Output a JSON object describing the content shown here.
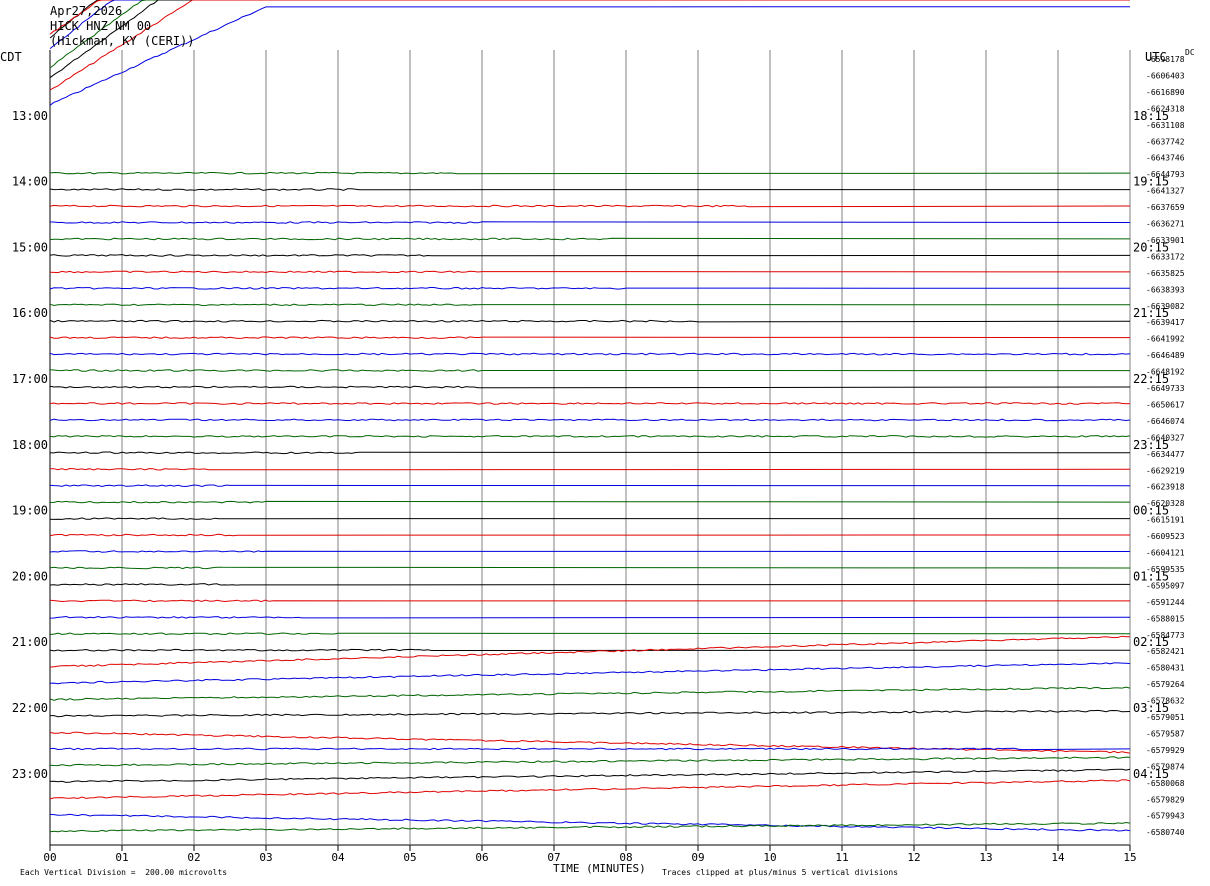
{
  "header": {
    "date": "Apr27,2026",
    "station": "HICK HNZ NM 00",
    "location": "(Hickman, KY (CERI))"
  },
  "labels": {
    "left_tz": "CDT",
    "right_tz": "UTC",
    "dc": "DC",
    "xaxis_title": "TIME (MINUTES)",
    "footer_left": "Each Vertical Division =  200.00 microvolts",
    "footer_right": "Traces clipped at plus/minus 5 vertical divisions"
  },
  "colors": {
    "cycle": [
      "#000000",
      "#e00000",
      "#0000e0",
      "#006400"
    ],
    "grid": "#808080"
  },
  "chart_data": {
    "type": "line",
    "title": "HICK HNZ NM 00",
    "xlabel": "TIME (MINUTES)",
    "xlim": [
      0,
      15
    ],
    "x_ticks": [
      "00",
      "01",
      "02",
      "03",
      "04",
      "05",
      "06",
      "07",
      "08",
      "09",
      "10",
      "11",
      "12",
      "13",
      "14",
      "15"
    ],
    "left_hour_labels": [
      "13:00",
      "14:00",
      "15:00",
      "16:00",
      "17:00",
      "18:00",
      "19:00",
      "20:00",
      "21:00",
      "22:00",
      "23:00"
    ],
    "right_hour_labels": [
      "18:15",
      "19:15",
      "20:15",
      "21:15",
      "22:15",
      "23:15",
      "00:15",
      "01:15",
      "02:15",
      "03:15",
      "04:15"
    ],
    "first_label_row": 4,
    "row_count": 48,
    "dc_offsets": [
      "-6598178",
      "-6606403",
      "-6616890",
      "-6624318",
      "-6631108",
      "-6637742",
      "-6643746",
      "-6644793",
      "-6641327",
      "-6637659",
      "-6636271",
      "-6633901",
      "-6633172",
      "-6635825",
      "-6638393",
      "-6639082",
      "-6639417",
      "-6641992",
      "-6646489",
      "-6648192",
      "-6649733",
      "-6650617",
      "-6646074",
      "-6640327",
      "-6634477",
      "-6629219",
      "-6623918",
      "-6620328",
      "-6615191",
      "-6609523",
      "-6604121",
      "-6599535",
      "-6595097",
      "-6591244",
      "-6588015",
      "-6584773",
      "-6582421",
      "-6580431",
      "-6579264",
      "-6578632",
      "-6579051",
      "-6579587",
      "-6579929",
      "-6579874",
      "-6580068",
      "-6579829",
      "-6579943",
      "-6580740"
    ],
    "traces_note": "Each trace row: [row, start_offset_px, end_minute, end_offset_px]; clipped ramps then flat",
    "traces": [
      [
        0,
        -20,
        2.2,
        -150
      ],
      [
        1,
        -40,
        2.2,
        -150
      ],
      [
        2,
        -42,
        1.9,
        -150
      ],
      [
        3,
        -40,
        2.1,
        -150
      ],
      [
        4,
        -46,
        2.0,
        -150
      ],
      [
        5,
        -50,
        2.2,
        -150
      ],
      [
        6,
        -52,
        3.0,
        -150
      ],
      [
        7,
        0,
        5.65,
        0
      ],
      [
        8,
        0,
        4.3,
        0
      ],
      [
        9,
        0,
        9.7,
        0
      ],
      [
        10,
        0,
        6.0,
        0
      ],
      [
        11,
        0,
        7.8,
        0
      ],
      [
        12,
        0,
        5.3,
        0
      ],
      [
        13,
        0,
        6.0,
        0
      ],
      [
        14,
        0,
        8.0,
        0
      ],
      [
        15,
        0,
        6.0,
        0
      ],
      [
        16,
        0,
        9.0,
        0
      ],
      [
        17,
        0,
        6.0,
        0
      ],
      [
        18,
        0,
        15,
        0
      ],
      [
        19,
        0,
        6.0,
        0
      ],
      [
        20,
        0,
        6.0,
        0
      ],
      [
        21,
        0,
        15,
        0
      ],
      [
        22,
        0,
        15,
        0
      ],
      [
        23,
        0,
        15,
        0
      ],
      [
        24,
        0,
        4.3,
        0
      ],
      [
        25,
        0,
        2.2,
        0
      ],
      [
        26,
        0,
        2.5,
        0
      ],
      [
        27,
        0,
        3.0,
        0
      ],
      [
        28,
        0,
        2.4,
        0
      ],
      [
        29,
        0,
        2.6,
        0
      ],
      [
        30,
        0,
        3.0,
        0
      ],
      [
        31,
        0,
        2.4,
        0
      ],
      [
        32,
        0,
        2.7,
        0
      ],
      [
        33,
        0,
        3.1,
        0
      ],
      [
        34,
        0,
        3.5,
        0
      ],
      [
        35,
        0,
        4.0,
        0
      ],
      [
        36,
        0,
        5.3,
        0
      ],
      [
        37,
        0,
        15,
        -30
      ],
      [
        38,
        0,
        15,
        -20
      ],
      [
        39,
        0,
        15,
        -12
      ],
      [
        40,
        0,
        15,
        -5
      ],
      [
        41,
        0,
        15,
        20
      ],
      [
        42,
        0,
        13.5,
        0
      ],
      [
        43,
        0,
        15,
        -8
      ],
      [
        44,
        0,
        15,
        -12
      ],
      [
        45,
        0,
        15,
        -18
      ],
      [
        46,
        0,
        15,
        16
      ],
      [
        47,
        0,
        15,
        -8
      ]
    ]
  }
}
